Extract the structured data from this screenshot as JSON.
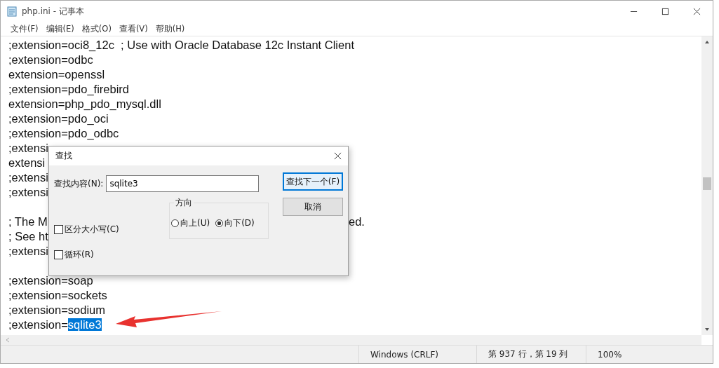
{
  "window": {
    "title": "php.ini - 记事本"
  },
  "menu": [
    "文件(F)",
    "编辑(E)",
    "格式(O)",
    "查看(V)",
    "帮助(H)"
  ],
  "editor": {
    "lines": [
      {
        "kind": "code",
        "text": ";extension=oci8_12c  ; Use with Oracle Database 12c Instant Client"
      },
      {
        "kind": "code",
        "text": ";extension=odbc"
      },
      {
        "kind": "code",
        "text": "extension=openssl"
      },
      {
        "kind": "code",
        "text": ";extension=pdo_firebird"
      },
      {
        "kind": "code",
        "text": "extension=php_pdo_mysql.dll"
      },
      {
        "kind": "code",
        "text": ";extension=pdo_oci"
      },
      {
        "kind": "code",
        "text": ";extension=pdo_odbc"
      },
      {
        "kind": "code",
        "text": ";extensi"
      },
      {
        "kind": "code",
        "text": "extensi"
      },
      {
        "kind": "code",
        "text": ";extensi"
      },
      {
        "kind": "code",
        "text": ";extensi"
      },
      {
        "kind": "blank"
      },
      {
        "kind": "code",
        "text": "; The M",
        "tail": "ed."
      },
      {
        "kind": "code",
        "text": "; See ht"
      },
      {
        "kind": "code",
        "text": ";extensi"
      },
      {
        "kind": "blank"
      },
      {
        "kind": "code",
        "text": ";extension=soap"
      },
      {
        "kind": "code",
        "text": ";extension=sockets"
      },
      {
        "kind": "code",
        "text": ";extension=sodium"
      },
      {
        "kind": "code",
        "text": ";extension=",
        "selection": "sqlite3"
      }
    ]
  },
  "find_dialog": {
    "title": "查找",
    "label": "查找内容(N):",
    "value": "sqlite3",
    "buttons": [
      {
        "label": "查找下一个(F)",
        "default": true
      },
      {
        "label": "取消",
        "default": false
      }
    ],
    "direction": {
      "title": "方向",
      "options": [
        {
          "label": "向上(U)",
          "selected": false
        },
        {
          "label": "向下(D)",
          "selected": true
        }
      ]
    },
    "checkboxes": [
      {
        "label": "区分大小写(C)",
        "checked": false
      },
      {
        "label": "循环(R)",
        "checked": false
      }
    ]
  },
  "status_bar": [
    "Windows (CRLF)",
    "第 937 行，第 19 列",
    "100%"
  ]
}
